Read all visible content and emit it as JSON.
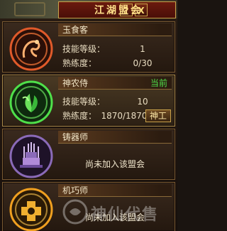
{
  "window": {
    "title": "江湖盟会",
    "help_glyph": "?",
    "close_glyph": "X"
  },
  "guilds": [
    {
      "name": "玉食客",
      "level_label": "技能等级：",
      "level_value": "1",
      "proficiency_label": "熟练度：",
      "proficiency_value": "0/30",
      "emblem_icon": "dragon-ring-icon",
      "emblem_color": "#e05a2a"
    },
    {
      "name": "神农侍",
      "current_label": "当前",
      "level_label": "技能等级：",
      "level_value": "10",
      "proficiency_label": "熟练度：",
      "proficiency_value": "1870/1870",
      "action_label": "神工",
      "emblem_icon": "herb-leaf-icon",
      "emblem_color": "#4fe04a"
    },
    {
      "name": "铸器师",
      "status_text": "尚未加入该盟会",
      "emblem_icon": "forge-shrine-icon",
      "emblem_color": "#b08ad8"
    },
    {
      "name": "机巧师",
      "status_text": "尚未加入该盟会",
      "emblem_icon": "gear-mechanism-icon",
      "emblem_color": "#f0a020"
    }
  ],
  "watermark_text": "神仙代售",
  "colors": {
    "accent_gold": "#c9a24a",
    "title_red": "#6b1a0e",
    "current_green": "#4fe04a"
  }
}
